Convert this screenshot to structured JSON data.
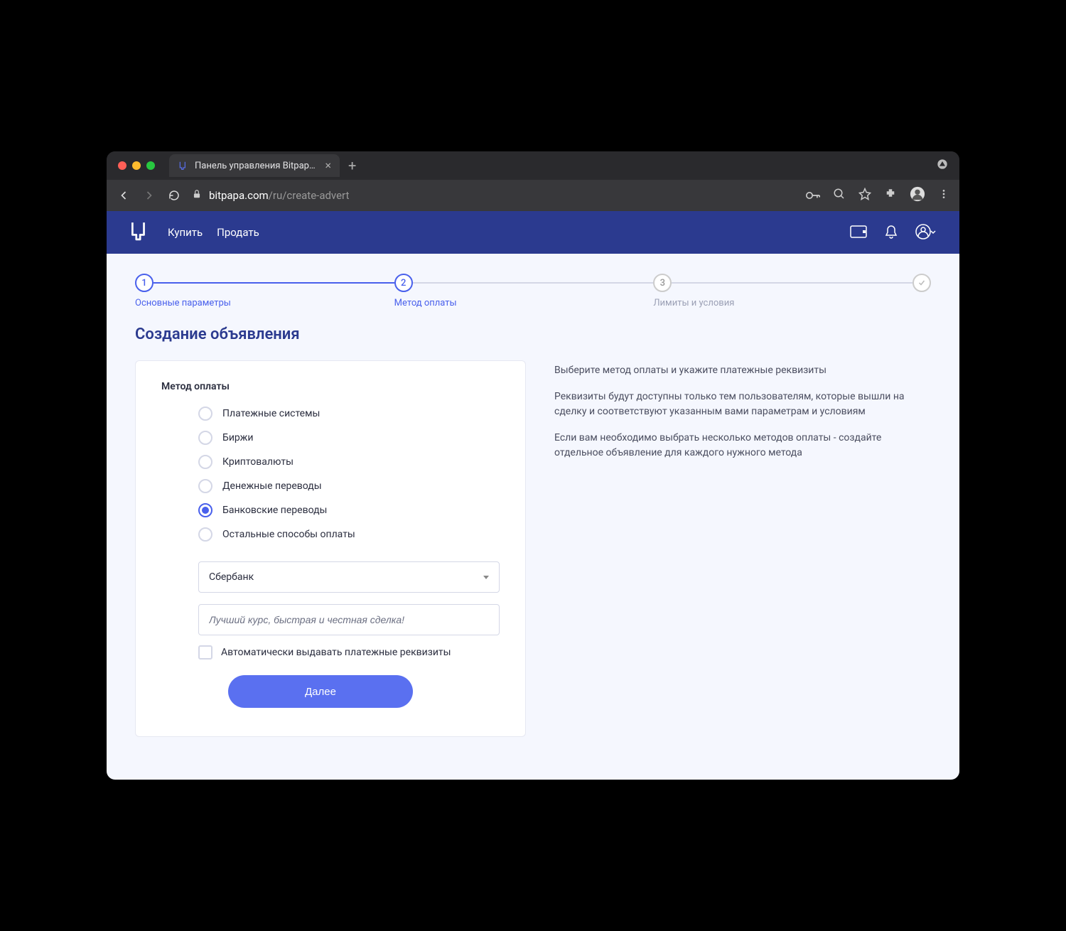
{
  "browser": {
    "tab_title": "Панель управления Bitpapa на",
    "url_host": "bitpapa.com",
    "url_path": "/ru/create-advert"
  },
  "header": {
    "nav": {
      "buy": "Купить",
      "sell": "Продать"
    }
  },
  "stepper": {
    "steps": [
      {
        "num": "1",
        "label": "Основные параметры"
      },
      {
        "num": "2",
        "label": "Метод оплаты"
      },
      {
        "num": "3",
        "label": "Лимиты и условия"
      }
    ]
  },
  "page_title": "Создание объявления",
  "card": {
    "title": "Метод оплаты",
    "options": [
      "Платежные системы",
      "Биржи",
      "Криптовалюты",
      "Денежные переводы",
      "Банковские переводы",
      "Остальные способы оплаты"
    ],
    "selected_index": 4,
    "bank_select": "Сбербанк",
    "tagline": "Лучший курс, быстрая и честная сделка!",
    "checkbox_label": "Автоматически выдавать платежные реквизиты",
    "submit": "Далее"
  },
  "info": {
    "p1": "Выберите метод оплаты и укажите платежные реквизиты",
    "p2": "Реквизиты будут доступны только тем пользователям, которые вышли на сделку и соответствуют указанным вами параметрам и условиям",
    "p3": "Если вам необходимо выбрать несколько методов оплаты - создайте отдельное объявление для каждого нужного метода"
  }
}
